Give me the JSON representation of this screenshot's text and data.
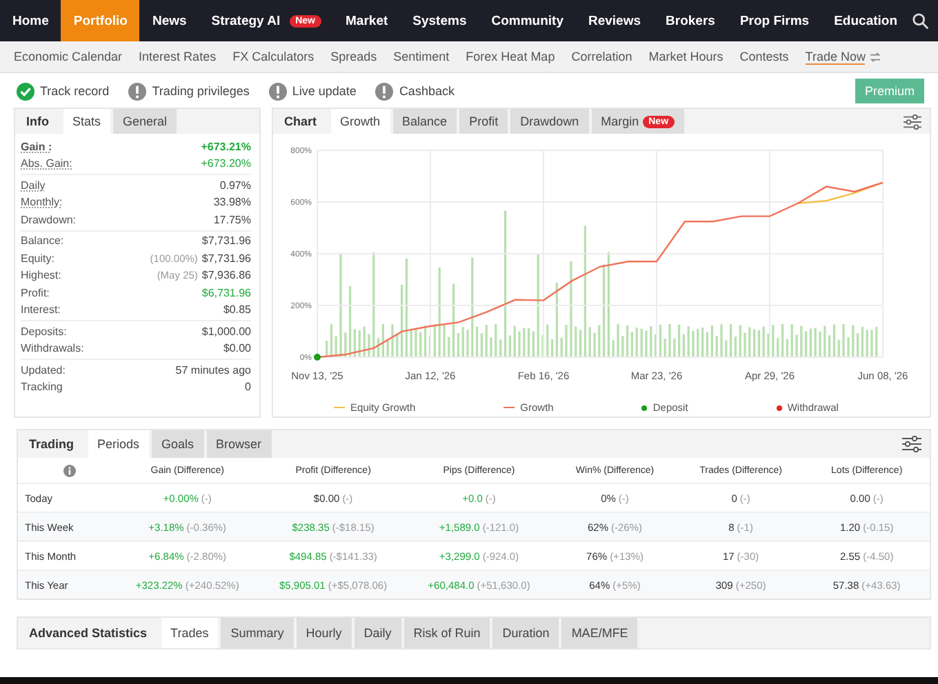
{
  "top_nav": {
    "items": [
      {
        "label": "Home",
        "selected": false
      },
      {
        "label": "Portfolio",
        "selected": true
      },
      {
        "label": "News",
        "selected": false
      },
      {
        "label": "Strategy AI",
        "selected": false,
        "badge": "New"
      },
      {
        "label": "Market",
        "selected": false
      },
      {
        "label": "Systems",
        "selected": false
      },
      {
        "label": "Community",
        "selected": false
      },
      {
        "label": "Reviews",
        "selected": false
      },
      {
        "label": "Brokers",
        "selected": false
      },
      {
        "label": "Prop Firms",
        "selected": false
      },
      {
        "label": "Education",
        "selected": false
      }
    ]
  },
  "sub_nav": {
    "items": [
      {
        "label": "Economic Calendar",
        "selected": false
      },
      {
        "label": "Interest Rates",
        "selected": false
      },
      {
        "label": "FX Calculators",
        "selected": false
      },
      {
        "label": "Spreads",
        "selected": false
      },
      {
        "label": "Sentiment",
        "selected": false
      },
      {
        "label": "Forex Heat Map",
        "selected": false
      },
      {
        "label": "Correlation",
        "selected": false
      },
      {
        "label": "Market Hours",
        "selected": false
      },
      {
        "label": "Contests",
        "selected": false
      },
      {
        "label": "Trade Now",
        "selected": true
      }
    ]
  },
  "badges": [
    {
      "label": "Track record",
      "verified": true
    },
    {
      "label": "Trading privileges",
      "verified": false
    },
    {
      "label": "Live update",
      "verified": false
    },
    {
      "label": "Cashback",
      "verified": false
    }
  ],
  "premium_button": "Premium",
  "stats_tabs": {
    "title": "Info",
    "tabs": [
      {
        "label": "Stats",
        "selected": true
      },
      {
        "label": "General",
        "selected": false
      }
    ]
  },
  "stats": [
    [
      {
        "label": "Gain :",
        "value": "+673.21%",
        "positive": true,
        "underlined": true,
        "strong": true
      },
      {
        "label": "Abs. Gain:",
        "value": "+673.20%",
        "positive": true,
        "underlined": true,
        "strong": false
      }
    ],
    [
      {
        "label": "Daily",
        "value": "0.97%",
        "positive": false,
        "underlined": true,
        "strong": false
      },
      {
        "label": "Monthly:",
        "value": "33.98%",
        "positive": false,
        "underlined": true,
        "strong": false
      },
      {
        "label": "Drawdown:",
        "value": "17.75%",
        "positive": false,
        "underlined": false,
        "strong": false
      }
    ],
    [
      {
        "label": "Balance:",
        "value": "$7,731.96",
        "positive": false,
        "underlined": false,
        "strong": false
      },
      {
        "label": "Equity:",
        "prefix": "(100.00%)",
        "value": "$7,731.96",
        "positive": false,
        "underlined": false,
        "strong": false
      },
      {
        "label": "Highest:",
        "prefix": "(May 25)",
        "value": "$7,936.86",
        "positive": false,
        "underlined": false,
        "strong": false
      },
      {
        "label": "Profit:",
        "value": "$6,731.96",
        "positive": true,
        "underlined": false,
        "strong": false
      },
      {
        "label": "Interest:",
        "value": "$0.85",
        "positive": false,
        "underlined": false,
        "strong": false
      }
    ],
    [
      {
        "label": "Deposits:",
        "value": "$1,000.00",
        "positive": false,
        "underlined": false,
        "strong": false
      },
      {
        "label": "Withdrawals:",
        "value": "$0.00",
        "positive": false,
        "underlined": false,
        "strong": false
      }
    ],
    [
      {
        "label": "Updated:",
        "value": "57 minutes ago",
        "positive": false,
        "underlined": false,
        "strong": false
      },
      {
        "label": "Tracking",
        "value": "0",
        "positive": false,
        "underlined": false,
        "strong": false
      }
    ]
  ],
  "chart_tabs": {
    "title": "Chart",
    "tabs": [
      {
        "label": "Growth",
        "selected": true
      },
      {
        "label": "Balance",
        "selected": false
      },
      {
        "label": "Profit",
        "selected": false
      },
      {
        "label": "Drawdown",
        "selected": false
      },
      {
        "label": "Margin",
        "selected": false,
        "badge": "New"
      }
    ]
  },
  "chart_data": {
    "type": "line",
    "ylim": [
      0,
      800
    ],
    "grid": true,
    "legend": "bottom",
    "yticks": [
      {
        "value": 0,
        "label": "0%"
      },
      {
        "value": 200,
        "label": "200%"
      },
      {
        "value": 400,
        "label": "400%"
      },
      {
        "value": 600,
        "label": "600%"
      },
      {
        "value": 800,
        "label": "800%"
      }
    ],
    "categories": [
      "Nov 13, '25",
      null,
      null,
      null,
      "Jan 12, '26",
      null,
      null,
      null,
      "Feb 16, '26",
      null,
      null,
      null,
      "Mar 23, '26",
      null,
      null,
      null,
      "Apr 29, '26",
      null,
      null,
      null,
      "Jun 08, '26"
    ],
    "series": [
      {
        "name": "Equity Growth",
        "color": "#f5c04a",
        "values": [
          null,
          null,
          null,
          null,
          null,
          null,
          null,
          null,
          null,
          null,
          null,
          null,
          null,
          null,
          null,
          null,
          null,
          595,
          605,
          635,
          675
        ]
      },
      {
        "name": "Growth",
        "color": "#f0735a",
        "values": [
          0,
          10,
          35,
          100,
          120,
          135,
          175,
          222,
          220,
          295,
          350,
          370,
          370,
          525,
          525,
          545,
          545,
          595,
          660,
          640,
          675
        ]
      }
    ]
  },
  "legend_markers": [
    {
      "label": "Deposit",
      "kind": "dot",
      "color": "#1a9e1a"
    },
    {
      "label": "Withdrawal",
      "kind": "dot",
      "color": "#e8241c"
    }
  ],
  "periods_tabs": {
    "title": "Trading",
    "tabs": [
      {
        "label": "Periods",
        "selected": true
      },
      {
        "label": "Goals",
        "selected": false
      },
      {
        "label": "Browser",
        "selected": false
      }
    ]
  },
  "periods_table": {
    "columns": [
      "Gain (Difference)",
      "Profit (Difference)",
      "Pips (Difference)",
      "Win% (Difference)",
      "Trades (Difference)",
      "Lots (Difference)"
    ],
    "rows": [
      {
        "label": "Today",
        "cells": [
          {
            "value": "+0.00%",
            "diff": "(-)",
            "positive": true
          },
          {
            "value": "$0.00",
            "diff": "(-)",
            "positive": false
          },
          {
            "value": "+0.0",
            "diff": "(-)",
            "positive": true
          },
          {
            "value": "0%",
            "diff": "(-)",
            "positive": false
          },
          {
            "value": "0",
            "diff": "(-)",
            "positive": false
          },
          {
            "value": "0.00",
            "diff": "(-)",
            "positive": false
          }
        ]
      },
      {
        "label": "This Week",
        "cells": [
          {
            "value": "+3.18%",
            "diff": "(-0.36%)",
            "positive": true
          },
          {
            "value": "$238.35",
            "diff": "(-$18.15)",
            "positive": true
          },
          {
            "value": "+1,589.0",
            "diff": "(-121.0)",
            "positive": true
          },
          {
            "value": "62%",
            "diff": "(-26%)",
            "positive": false
          },
          {
            "value": "8",
            "diff": "(-1)",
            "positive": false
          },
          {
            "value": "1.20",
            "diff": "(-0.15)",
            "positive": false
          }
        ]
      },
      {
        "label": "This Month",
        "cells": [
          {
            "value": "+6.84%",
            "diff": "(-2.80%)",
            "positive": true
          },
          {
            "value": "$494.85",
            "diff": "(-$141.33)",
            "positive": true
          },
          {
            "value": "+3,299.0",
            "diff": "(-924.0)",
            "positive": true
          },
          {
            "value": "76%",
            "diff": "(+13%)",
            "positive": false
          },
          {
            "value": "17",
            "diff": "(-30)",
            "positive": false
          },
          {
            "value": "2.55",
            "diff": "(-4.50)",
            "positive": false
          }
        ]
      },
      {
        "label": "This Year",
        "cells": [
          {
            "value": "+323.22%",
            "diff": "(+240.52%)",
            "positive": true
          },
          {
            "value": "$5,905.01",
            "diff": "(+$5,078.06)",
            "positive": true
          },
          {
            "value": "+60,484.0",
            "diff": "(+51,630.0)",
            "positive": true
          },
          {
            "value": "64%",
            "diff": "(+5%)",
            "positive": false
          },
          {
            "value": "309",
            "diff": "(+250)",
            "positive": false
          },
          {
            "value": "57.38",
            "diff": "(+43.63)",
            "positive": false
          }
        ]
      }
    ]
  },
  "advanced_tabs": {
    "title": "Advanced Statistics",
    "tabs": [
      {
        "label": "Trades",
        "selected": true
      },
      {
        "label": "Summary",
        "selected": false
      },
      {
        "label": "Hourly",
        "selected": false
      },
      {
        "label": "Daily",
        "selected": false
      },
      {
        "label": "Risk of Ruin",
        "selected": false
      },
      {
        "label": "Duration",
        "selected": false
      },
      {
        "label": "MAE/MFE",
        "selected": false
      }
    ]
  }
}
